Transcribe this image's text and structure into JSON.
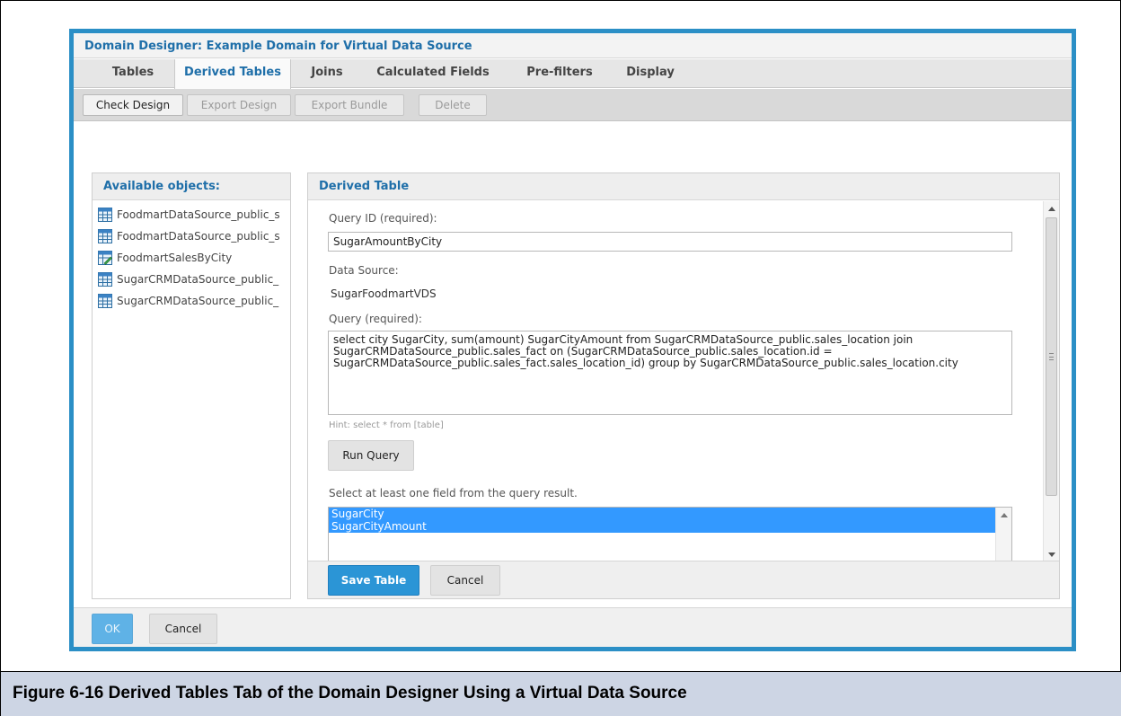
{
  "dialog": {
    "title": "Domain Designer: Example Domain for Virtual Data Source",
    "tabs": [
      {
        "label": "Tables",
        "active": false
      },
      {
        "label": "Derived Tables",
        "active": true
      },
      {
        "label": "Joins",
        "active": false
      },
      {
        "label": "Calculated Fields",
        "active": false
      },
      {
        "label": "Pre-filters",
        "active": false
      },
      {
        "label": "Display",
        "active": false
      }
    ],
    "toolbar": {
      "check_design": "Check Design",
      "export_design": "Export Design",
      "export_bundle": "Export Bundle",
      "delete": "Delete"
    },
    "footer": {
      "ok": "OK",
      "cancel": "Cancel"
    }
  },
  "available_objects": {
    "header": "Available objects:",
    "items": [
      {
        "label": "FoodmartDataSource_public_s",
        "icon": "table-icon"
      },
      {
        "label": "FoodmartDataSource_public_s",
        "icon": "table-icon"
      },
      {
        "label": "FoodmartSalesByCity",
        "icon": "derived-table-icon"
      },
      {
        "label": "SugarCRMDataSource_public_",
        "icon": "table-icon"
      },
      {
        "label": "SugarCRMDataSource_public_",
        "icon": "table-icon"
      }
    ]
  },
  "derived_table": {
    "header": "Derived Table",
    "query_id_label": "Query ID (required):",
    "query_id_value": "SugarAmountByCity",
    "data_source_label": "Data Source:",
    "data_source_value": "SugarFoodmartVDS",
    "query_label": "Query (required):",
    "query_value": "select city SugarCity, sum(amount) SugarCityAmount from SugarCRMDataSource_public.sales_location join SugarCRMDataSource_public.sales_fact on (SugarCRMDataSource_public.sales_location.id = SugarCRMDataSource_public.sales_fact.sales_location_id) group by SugarCRMDataSource_public.sales_location.city",
    "hint": "Hint: select * from [table]",
    "run_query": "Run Query",
    "select_label": "Select at least one field from the query result.",
    "fields": [
      "SugarCity",
      "SugarCityAmount"
    ],
    "save_table": "Save Table",
    "cancel": "Cancel"
  },
  "caption": "Figure 6-16    Derived Tables Tab of the Domain Designer Using a Virtual Data Source",
  "colors": {
    "accent": "#2b8fc6",
    "title_text": "#1f6fa9",
    "selection": "#3399ff",
    "caption_bg": "#cdd5e4"
  }
}
